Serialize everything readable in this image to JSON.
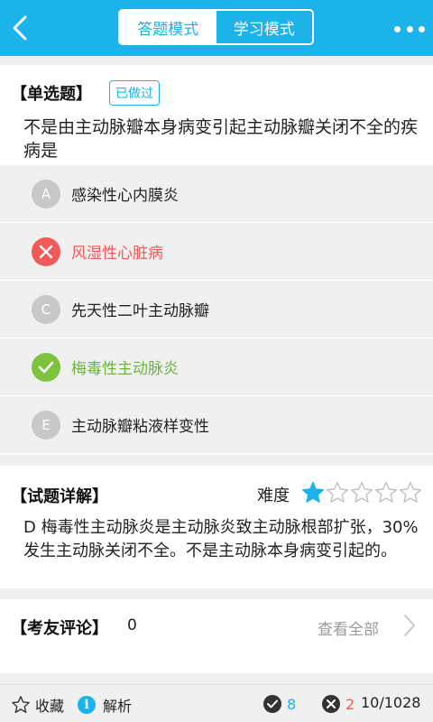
{
  "header": {
    "tabs": [
      {
        "label": "答题模式",
        "active": true
      },
      {
        "label": "学习模式",
        "active": false
      }
    ],
    "back_icon": "chevron-left-icon",
    "more_icon": "more-dots-icon",
    "accent_color": "#1cb2ea"
  },
  "question": {
    "type_label": "【单选题】",
    "status_badge": "已做过",
    "text": "不是由主动脉瓣本身病变引起主动脉瓣关闭不全的疾病是",
    "options": [
      {
        "letter": "A",
        "text": "感染性心内膜炎",
        "state": "normal"
      },
      {
        "letter": "B",
        "text": "风湿性心脏病",
        "state": "wrong"
      },
      {
        "letter": "C",
        "text": "先天性二叶主动脉瓣",
        "state": "normal"
      },
      {
        "letter": "D",
        "text": "梅毒性主动脉炎",
        "state": "correct"
      },
      {
        "letter": "E",
        "text": "主动脉瓣粘液样变性",
        "state": "normal"
      }
    ]
  },
  "explanation": {
    "title": "【试题详解】",
    "difficulty_label": "难度",
    "difficulty_rating": 1,
    "difficulty_max": 5,
    "text": "D 梅毒性主动脉炎是主动脉炎致主动脉根部扩张，30%发生主动脉关闭不全。不是主动脉本身病变引起的。"
  },
  "comments": {
    "title": "【考友评论】",
    "count": "0",
    "view_all": "查看全部"
  },
  "bottom_bar": {
    "favorite_label": "收藏",
    "analysis_label": "解析",
    "info_glyph": "i",
    "correct_count": "8",
    "wrong_count": "2",
    "progress": "10/1028"
  }
}
